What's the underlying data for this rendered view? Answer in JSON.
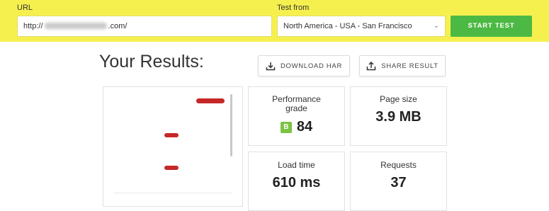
{
  "form": {
    "url_label": "URL",
    "url_prefix": "http://",
    "url_suffix": ".com/",
    "test_from_label": "Test from",
    "test_from_value": "North America - USA - San Francisco",
    "start_label": "START TEST"
  },
  "results": {
    "heading": "Your Results:",
    "download_label": "DOWNLOAD HAR",
    "share_label": "SHARE RESULT"
  },
  "metrics": {
    "performance": {
      "label_line1": "Performance",
      "label_line2": "grade",
      "grade": "B",
      "value": "84"
    },
    "page_size": {
      "label": "Page size",
      "value": "3.9 MB"
    },
    "load_time": {
      "label": "Load time",
      "value": "610 ms"
    },
    "requests": {
      "label": "Requests",
      "value": "37"
    }
  },
  "colors": {
    "topbar": "#f6f04f",
    "start_button": "#4cb944",
    "grade_badge": "#7cc243",
    "preview_accent": "#c62828"
  },
  "icons": {
    "download": "download-icon",
    "share": "share-icon",
    "select_arrow": "chevron-down-icon"
  }
}
